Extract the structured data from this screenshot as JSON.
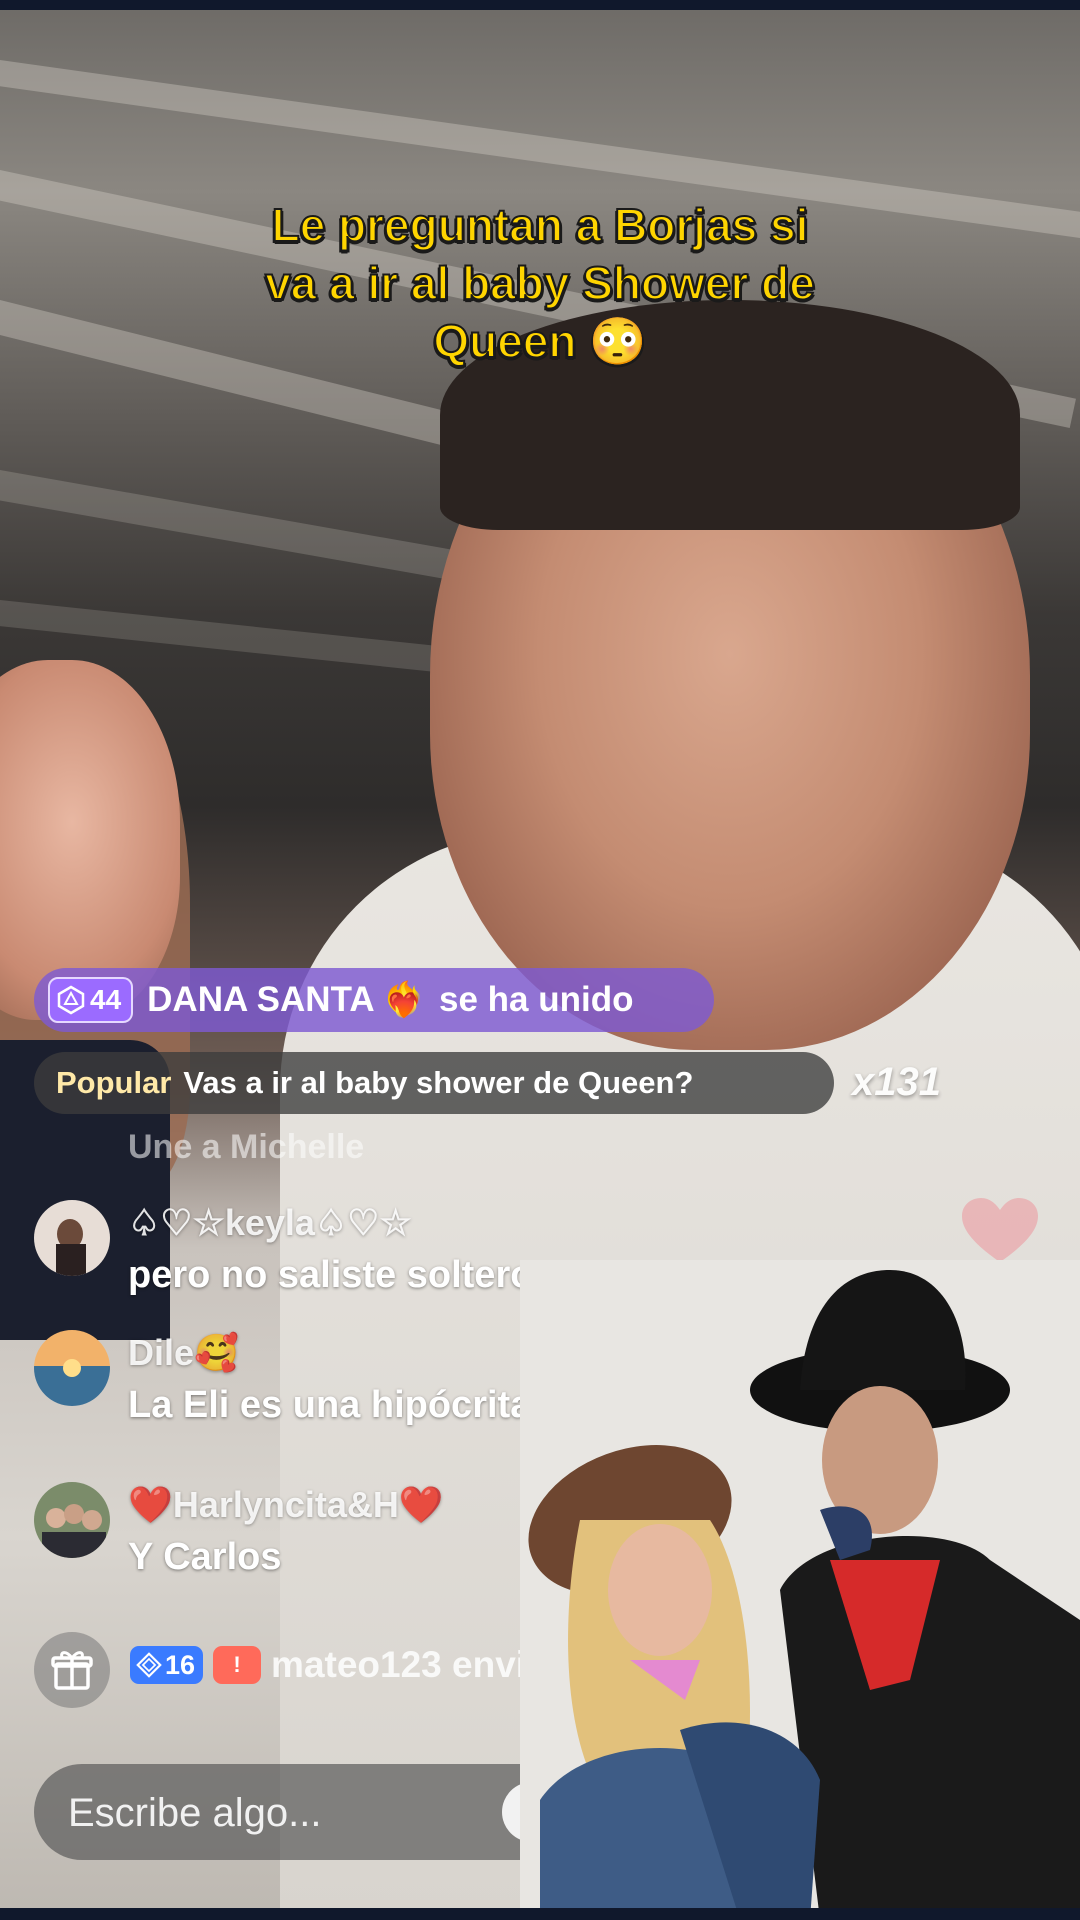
{
  "caption": {
    "line1": "Le preguntan a Borjas si",
    "line2": "va a ir al baby Shower de",
    "line3": "Queen 😳"
  },
  "join_notice": {
    "level": "44",
    "name": "DANA SANTA",
    "heart": "❤️‍🔥",
    "message": "se ha unido",
    "color": "#7e5ad2"
  },
  "popular": {
    "tag": "Popular",
    "question": "Vas a ir al baby shower de Queen?",
    "count": "x131"
  },
  "faded_comment": "Une a Michelle",
  "comments": [
    {
      "user": "♤♡☆keyla♤♡☆",
      "text": "pero no saliste soltero"
    },
    {
      "user": "Dile🥰",
      "text": "La Eli es una hipócrita"
    },
    {
      "user": "❤️Harlyncita&H❤️",
      "text": "Y Carlos"
    }
  ],
  "gift": {
    "level": "16",
    "badge": "!",
    "text": "mateo123 envió"
  },
  "input": {
    "placeholder": "Escribe algo..."
  },
  "icons": {
    "gift": "gift-icon",
    "emoji": "smiley-icon",
    "heart": "heart-icon",
    "level": "level-gem-icon"
  },
  "colors": {
    "caption": "#ffd500",
    "heart": "#e8213a",
    "popular_tag": "#ffe9a8"
  }
}
